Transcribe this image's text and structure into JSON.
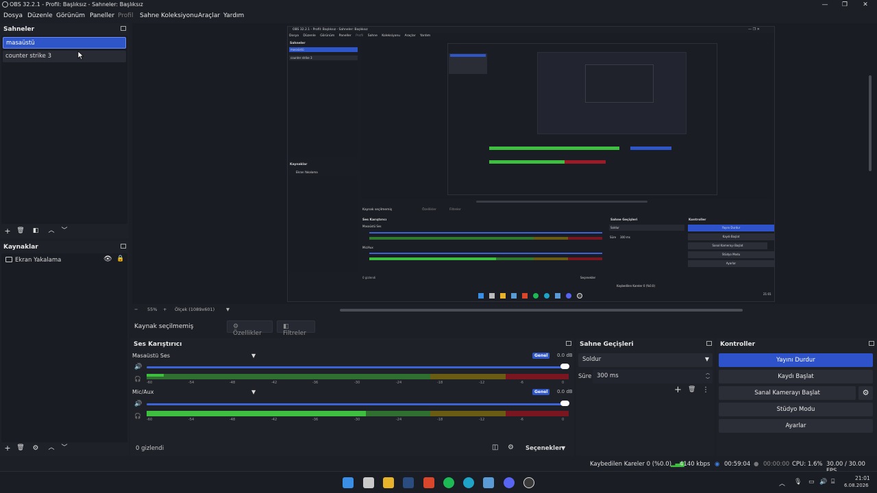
{
  "window": {
    "title": "OBS 32.2.1 - Profil: Başlıksız - Sahneler: Başlıksız"
  },
  "menu": [
    "Dosya",
    "Düzenle",
    "Görünüm",
    "Paneller",
    "Profil",
    "Sahne Koleksiyonu",
    "Araçlar",
    "Yardım"
  ],
  "scenes": {
    "title": "Sahneler",
    "items": [
      {
        "label": "masaüstü",
        "selected": true
      },
      {
        "label": "counter strike 3",
        "selected": false
      }
    ]
  },
  "sources": {
    "title": "Kaynaklar",
    "items": [
      {
        "label": "Ekran Yakalama",
        "visible": true,
        "locked": false
      }
    ]
  },
  "preview": {
    "zoom": "55%",
    "scale_mode": "Ölçek (1089x601)",
    "capture": {
      "title": "OBS 32.2.1 - Profil: Başlıksız - Sahneler: Başlıksız",
      "menu": [
        "Dosya",
        "Düzenle",
        "Görünüm",
        "Paneller",
        "Profil",
        "Sahne Koleksiyonu",
        "Araçlar",
        "Yardım"
      ],
      "scenes_title": "Sahneler",
      "scene_items": [
        "masaüstü",
        "counter strike 3"
      ],
      "sources_title": "Kaynaklar",
      "source_item": "Ekran Yakalama",
      "no_source": "Kaynak seçilmemiş",
      "props": "Özellikler",
      "filters": "Filtreler",
      "mixer_title": "Ses Karıştırıcı",
      "track1": "Masaüstü Ses",
      "track2": "Mic/Aux",
      "transitions_title": "Sahne Geçişleri",
      "transition": "Soldur",
      "duration_label": "Süre",
      "duration": "300 ms",
      "controls_title": "Kontroller",
      "controls": [
        "Yayını Durdur",
        "Kaydı Başlat",
        "Sanal Kamerayı Başlat",
        "Stüdyo Modu",
        "Ayarlar"
      ],
      "hidden": "0 gizlendi",
      "options": "Seçenekler",
      "status": "Kaybedilen Kareler 0 (%0.0)",
      "clock": "21:01"
    }
  },
  "context_bar": {
    "no_source": "Kaynak seçilmemiş",
    "properties": "Özellikler",
    "filters": "Filtreler"
  },
  "mixer": {
    "title": "Ses Karıştırıcı",
    "tracks": [
      {
        "name": "Masaüstü Ses",
        "badge": "Genel",
        "db": "0.0 dB",
        "volume": 1.0,
        "level": 0.04
      },
      {
        "name": "Mic/Aux",
        "badge": "Genel",
        "db": "0.0 dB",
        "volume": 1.0,
        "level": 0.52
      }
    ],
    "ticks": [
      "-60",
      "-54",
      "-48",
      "-42",
      "-36",
      "-30",
      "-24",
      "-18",
      "-12",
      "-6",
      "0"
    ],
    "hidden_label": "0 gizlendi",
    "options_label": "Seçenekler"
  },
  "transitions": {
    "title": "Sahne Geçişleri",
    "selected": "Soldur",
    "duration_label": "Süre",
    "duration": "300 ms"
  },
  "controls": {
    "title": "Kontroller",
    "stop_stream": "Yayını Durdur",
    "start_recording": "Kaydı Başlat",
    "start_virtualcam": "Sanal Kamerayı Başlat",
    "studio_mode": "Stüdyo Modu",
    "settings": "Ayarlar"
  },
  "status": {
    "dropped_frames": "Kaybedilen Kareler 0 (%0.0)",
    "bitrate": "4140 kbps",
    "stream_time": "00:59:04",
    "record_time": "00:00:00",
    "cpu": "CPU: 1.6%",
    "fps": "30.00 / 30.00 FPS"
  },
  "taskbar": {
    "time": "21:01",
    "date": "6.08.2026"
  },
  "colors": {
    "accent": "#2d52c9",
    "meter_green": "#3fbf3f",
    "meter_yellow": "#a08a18",
    "meter_red": "#9b1c28",
    "volume_track": "#3d63d8"
  }
}
